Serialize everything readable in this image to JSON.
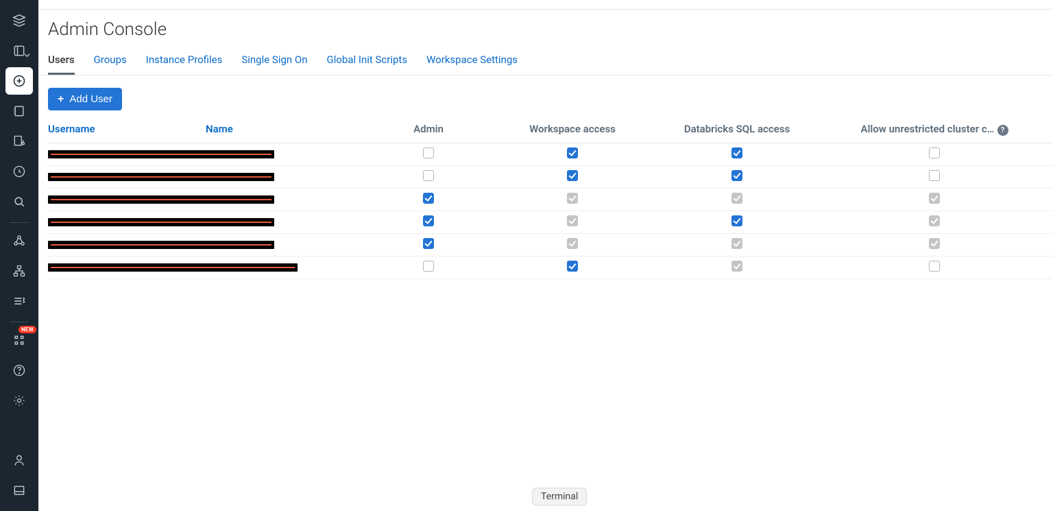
{
  "page": {
    "title": "Admin Console"
  },
  "tabs": [
    {
      "label": "Users",
      "active": true
    },
    {
      "label": "Groups"
    },
    {
      "label": "Instance Profiles"
    },
    {
      "label": "Single Sign On"
    },
    {
      "label": "Global Init Scripts"
    },
    {
      "label": "Workspace Settings"
    }
  ],
  "toolbar": {
    "add_user_label": "Add User"
  },
  "table": {
    "columns": [
      {
        "key": "username",
        "label": "Username",
        "sortable": true
      },
      {
        "key": "name",
        "label": "Name",
        "sortable": true
      },
      {
        "key": "admin",
        "label": "Admin",
        "center": true
      },
      {
        "key": "workspace",
        "label": "Workspace access",
        "center": true
      },
      {
        "key": "sql",
        "label": "Databricks SQL access",
        "center": true
      },
      {
        "key": "cluster",
        "label": "Allow unrestricted cluster c…",
        "center": true,
        "help": true
      }
    ],
    "rows": [
      {
        "redact_w": 330,
        "admin": "unchecked",
        "workspace": "checked",
        "sql": "checked",
        "cluster": "unchecked"
      },
      {
        "redact_w": 330,
        "admin": "unchecked",
        "workspace": "checked",
        "sql": "checked",
        "cluster": "unchecked"
      },
      {
        "redact_w": 330,
        "admin": "checked",
        "workspace": "disabled-checked",
        "sql": "disabled-checked",
        "cluster": "disabled-checked"
      },
      {
        "redact_w": 330,
        "admin": "checked",
        "workspace": "disabled-checked",
        "sql": "checked",
        "cluster": "disabled-checked"
      },
      {
        "redact_w": 330,
        "admin": "checked",
        "workspace": "disabled-checked",
        "sql": "disabled-checked",
        "cluster": "disabled-checked"
      },
      {
        "redact_w": 364,
        "admin": "unchecked",
        "workspace": "checked",
        "sql": "disabled-checked",
        "cluster": "unchecked"
      }
    ]
  },
  "sidebar": {
    "badge_new": "NEW",
    "items": [
      "logo",
      "data",
      "create",
      "notebook",
      "git",
      "recents",
      "search",
      "compute",
      "workflows",
      "jobs",
      "ml",
      "help",
      "settings",
      "user",
      "panel"
    ]
  },
  "terminal": {
    "label": "Terminal"
  }
}
